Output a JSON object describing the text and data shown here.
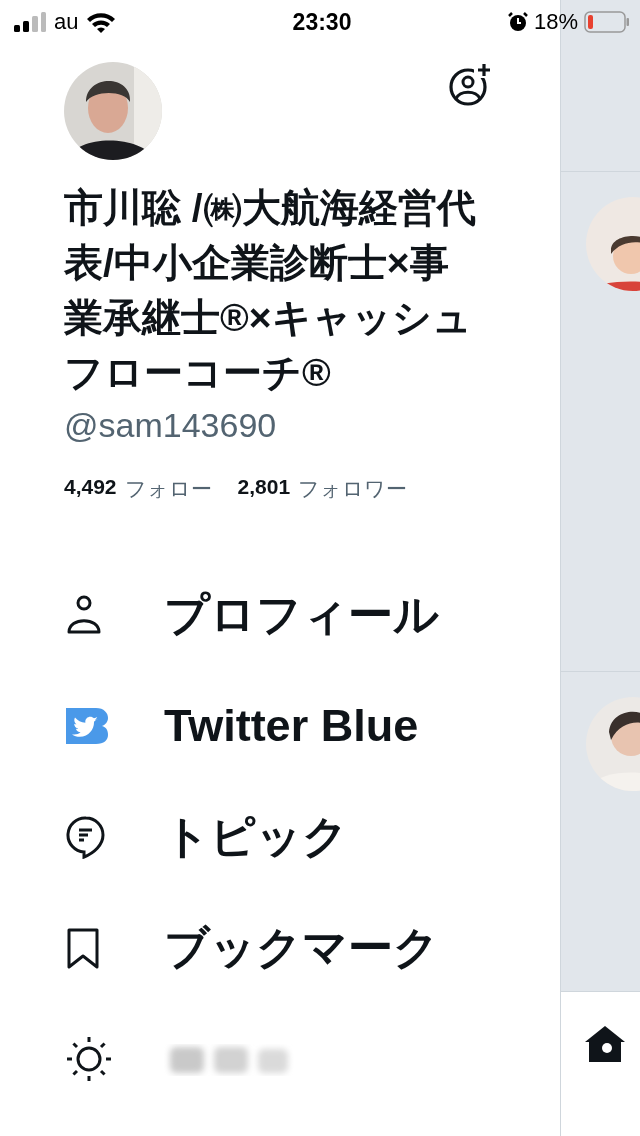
{
  "status_bar": {
    "carrier": "au",
    "time": "23:30",
    "battery_percent": "18%"
  },
  "profile": {
    "name": "市川聡 /㈱大航海経営代表/中小企業診断士×事業承継士®×キャッシュフローコーチ®",
    "handle": "@sam143690",
    "stats": [
      {
        "count": "4,492",
        "label": "フォロー"
      },
      {
        "count": "2,801",
        "label": "フォロワー"
      }
    ]
  },
  "menu": [
    {
      "kind": "profile",
      "label": "プロフィール"
    },
    {
      "kind": "blue",
      "label": "Twitter Blue"
    },
    {
      "kind": "topic",
      "label": "トピック"
    },
    {
      "kind": "bookmark",
      "label": "ブックマーク"
    },
    {
      "kind": "list"
    }
  ]
}
